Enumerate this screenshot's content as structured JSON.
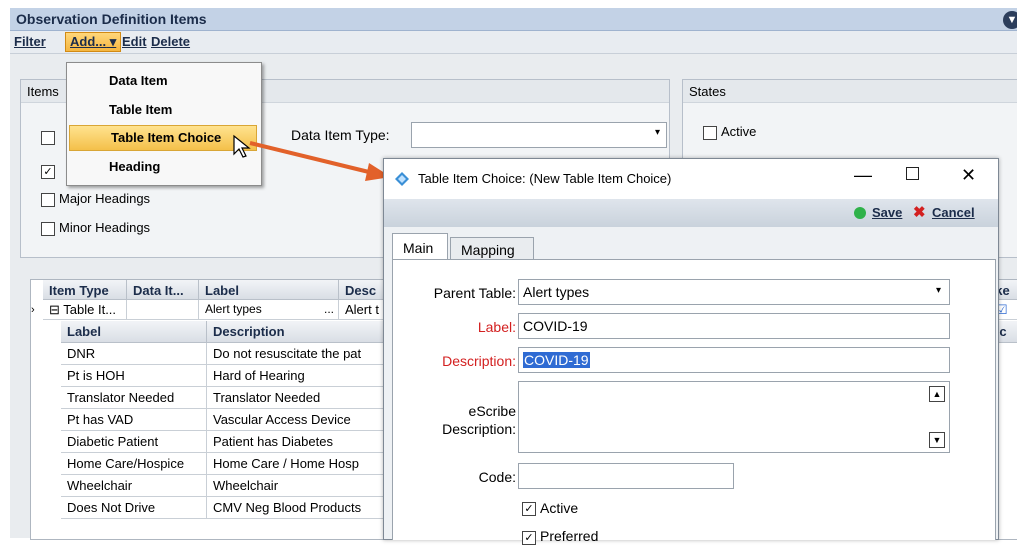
{
  "window": {
    "title": "Observation Definition Items",
    "collapse_icon": "chevron-circle-icon"
  },
  "menu": {
    "filter": "Filter",
    "add": "Add...",
    "edit": "Edit",
    "delete": "Delete"
  },
  "add_menu": {
    "items": [
      "Data Item",
      "Table Item",
      "Table Item Choice",
      "Heading"
    ],
    "highlighted": "Table Item Choice"
  },
  "items_group": {
    "title": "Items",
    "checkboxes": [
      {
        "label": "",
        "checked": false
      },
      {
        "label": "",
        "checked": true
      },
      {
        "label": "Major Headings",
        "checked": false
      },
      {
        "label": "Minor Headings",
        "checked": false
      }
    ],
    "data_item_type_label": "Data Item Type:",
    "data_item_type_value": ""
  },
  "states_group": {
    "title": "States",
    "active_label": "Active",
    "active_checked": false
  },
  "grid": {
    "columns": [
      "Item Type",
      "Data It...",
      "Label",
      "Desc",
      "cke"
    ],
    "parent_row": {
      "type": "Table It...",
      "data_item": "",
      "label": "Alert types",
      "desc": "Alert t"
    },
    "sub_columns": [
      "Label",
      "Description",
      "Ac"
    ],
    "rows": [
      [
        "DNR",
        "Do not resuscitate the pat"
      ],
      [
        "Pt is HOH",
        "Hard of Hearing"
      ],
      [
        "Translator Needed",
        "Translator Needed"
      ],
      [
        "Pt has VAD",
        "Vascular Access Device"
      ],
      [
        "Diabetic Patient",
        "Patient has Diabetes"
      ],
      [
        "Home Care/Hospice",
        "Home Care / Home Hosp"
      ],
      [
        "Wheelchair",
        "Wheelchair"
      ],
      [
        "Does Not Drive",
        "CMV Neg Blood Products"
      ]
    ]
  },
  "dialog": {
    "title": "Table Item Choice: (New Table Item Choice)",
    "save": "Save",
    "cancel": "Cancel",
    "tabs": [
      "Main",
      "Mapping"
    ],
    "parent_table_label": "Parent Table:",
    "parent_table_value": "Alert types",
    "label_label": "Label:",
    "label_value": "COVID-19",
    "description_label": "Description:",
    "description_value": "COVID-19",
    "escribe_label_1": "eScribe",
    "escribe_label_2": "Description:",
    "code_label": "Code:",
    "code_value": "",
    "active_label": "Active",
    "preferred_label": "Preferred"
  },
  "colors": {
    "accent_arrow": "#e2612a",
    "required_label": "#d32020",
    "title_bg": "#c3d2e6"
  }
}
